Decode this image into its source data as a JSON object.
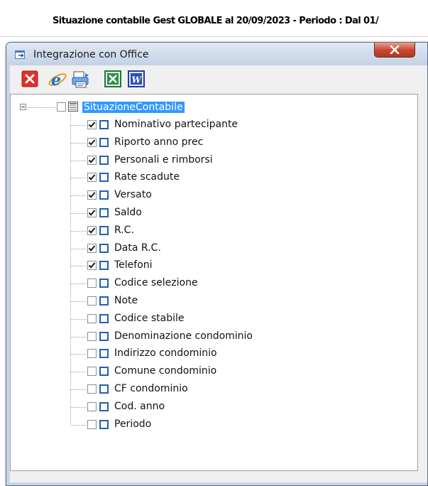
{
  "background_window": {
    "title": "Situazione contabile Gest GLOBALE al 20/09/2023 - Periodo : Dal 01/"
  },
  "dialog": {
    "title": "Integrazione con Office",
    "close_icon": "close-x-icon"
  },
  "toolbar": {
    "buttons": [
      {
        "name": "close-red-x-icon",
        "color": "#e0302a"
      },
      {
        "name": "internet-explorer-icon",
        "color": "#1f6fd0"
      },
      {
        "name": "export-print-icon",
        "color": "#2a7bd8"
      },
      {
        "name": "excel-icon",
        "color": "#1f7a3a"
      },
      {
        "name": "word-icon",
        "color": "#1f3d9c"
      }
    ]
  },
  "tree": {
    "root": {
      "label": "SituazioneContabile",
      "checked": false,
      "expanded": true
    },
    "items": [
      {
        "label": "Nominativo partecipante",
        "checked": true
      },
      {
        "label": "Riporto anno prec",
        "checked": true
      },
      {
        "label": "Personali e rimborsi",
        "checked": true
      },
      {
        "label": "Rate scadute",
        "checked": true
      },
      {
        "label": "Versato",
        "checked": true
      },
      {
        "label": "Saldo",
        "checked": true
      },
      {
        "label": "R.C.",
        "checked": true
      },
      {
        "label": "Data R.C.",
        "checked": true
      },
      {
        "label": "Telefoni",
        "checked": true
      },
      {
        "label": "Codice selezione",
        "checked": false
      },
      {
        "label": "Note",
        "checked": false
      },
      {
        "label": "Codice stabile",
        "checked": false
      },
      {
        "label": "Denominazione condominio",
        "checked": false
      },
      {
        "label": "Indirizzo condominio",
        "checked": false
      },
      {
        "label": "Comune condominio",
        "checked": false
      },
      {
        "label": "CF condominio",
        "checked": false
      },
      {
        "label": "Cod. anno",
        "checked": false
      },
      {
        "label": "Periodo",
        "checked": false
      }
    ]
  },
  "colors": {
    "selection": "#3399ff",
    "field_icon": "#1f5fb8",
    "frame": "#c8d6e6"
  }
}
